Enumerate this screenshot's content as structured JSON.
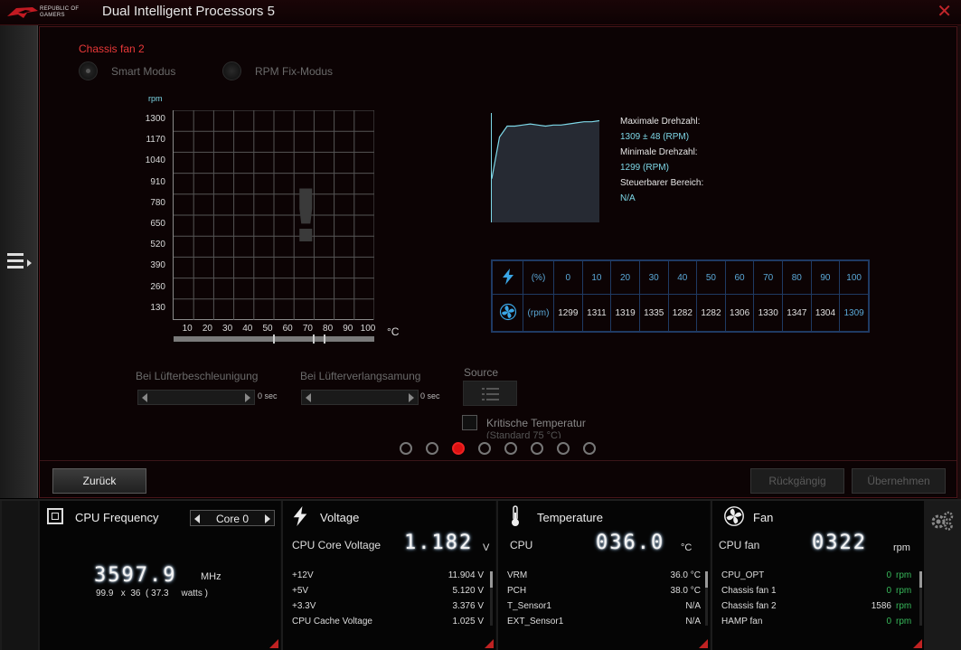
{
  "app": {
    "logo_text": "REPUBLIC OF\nGAMERS",
    "title": "Dual Intelligent Processors 5",
    "close_icon": "close-icon",
    "menu_icon": "menu-expand-icon"
  },
  "fan_panel": {
    "fan_name": "Chassis fan 2",
    "modes": [
      {
        "label": "Smart Modus",
        "selected": true
      },
      {
        "label": "RPM Fix-Modus",
        "selected": false
      }
    ],
    "chart_ylabel": "rpm",
    "chart_xunit": "°C",
    "warning_glyph": "!"
  },
  "chart_data": {
    "type": "line",
    "title": "",
    "xlabel": "°C",
    "ylabel": "rpm",
    "x_ticks": [
      "10",
      "20",
      "30",
      "40",
      "50",
      "60",
      "70",
      "80",
      "90",
      "100"
    ],
    "y_ticks": [
      "1300",
      "1170",
      "1040",
      "910",
      "780",
      "650",
      "520",
      "390",
      "260",
      "130"
    ],
    "xlim": [
      0,
      100
    ],
    "ylim": [
      0,
      1300
    ],
    "grid": true,
    "series": [],
    "range_markers": [
      50,
      70,
      75
    ]
  },
  "rpm_monitor": {
    "max_label": "Maximale Drehzahl:",
    "max_value": "1309 ± 48 (RPM)",
    "min_label": "Minimale Drehzahl:",
    "min_value": "1299 (RPM)",
    "range_label": "Steuerbarer Bereich:",
    "range_value": "N/A",
    "trace": [
      40,
      78,
      88,
      88,
      89,
      90,
      89,
      88,
      89,
      89,
      90,
      91,
      92,
      92,
      93
    ]
  },
  "duty_table": {
    "pct_unit": "(%)",
    "rpm_unit": "(rpm)",
    "percentages": [
      "0",
      "10",
      "20",
      "30",
      "40",
      "50",
      "60",
      "70",
      "80",
      "90",
      "100"
    ],
    "rpms": [
      "1299",
      "1311",
      "1319",
      "1335",
      "1282",
      "1282",
      "1306",
      "1330",
      "1347",
      "1304",
      "1309"
    ]
  },
  "controls": {
    "accel_label": "Bei Lüfterbeschleunigung",
    "accel_value": "0 sec",
    "decel_label": "Bei Lüfterverlangsamung",
    "decel_value": "0 sec",
    "source_label": "Source",
    "crit_label": "Kritische Temperatur",
    "crit_sub": "(Standard 75 °C)",
    "pages": 8,
    "active_page": 3
  },
  "footer": {
    "back": "Zurück",
    "undo": "Rückgängig",
    "apply": "Übernehmen"
  },
  "widgets": {
    "cpu": {
      "title": "CPU Frequency",
      "core": "Core 0",
      "freq": "3597.9",
      "freq_unit": "MHz",
      "detail": "99.9   x  36  ( 37.3     watts )"
    },
    "voltage": {
      "title": "Voltage",
      "main_label": "CPU Core Voltage",
      "main_value": "1.182",
      "main_unit": "V",
      "rows": [
        {
          "label": "+12V",
          "value": "11.904  V"
        },
        {
          "label": "+5V",
          "value": "5.120  V"
        },
        {
          "label": "+3.3V",
          "value": "3.376  V"
        },
        {
          "label": "CPU Cache Voltage",
          "value": "1.025  V"
        }
      ]
    },
    "temperature": {
      "title": "Temperature",
      "main_label": "CPU",
      "main_value": "036.0",
      "main_unit": "°C",
      "rows": [
        {
          "label": "VRM",
          "value": "36.0 °C"
        },
        {
          "label": "PCH",
          "value": "38.0 °C"
        },
        {
          "label": "T_Sensor1",
          "value": "N/A"
        },
        {
          "label": "EXT_Sensor1",
          "value": "N/A"
        }
      ]
    },
    "fan": {
      "title": "Fan",
      "main_label": "CPU fan",
      "main_value": "0322",
      "main_unit": "rpm",
      "rows": [
        {
          "label": "CPU_OPT",
          "value": "0",
          "unit": "rpm",
          "green": true
        },
        {
          "label": "Chassis fan 1",
          "value": "0",
          "unit": "rpm",
          "green": true
        },
        {
          "label": "Chassis fan 2",
          "value": "1586",
          "unit": "rpm",
          "green": false
        },
        {
          "label": "HAMP fan",
          "value": "0",
          "unit": "rpm",
          "green": true
        }
      ]
    }
  },
  "colors": {
    "accent_red": "#e83838",
    "cyan": "#7ed8e8",
    "table_blue": "#1f3a63",
    "status_green": "#37b85a"
  }
}
